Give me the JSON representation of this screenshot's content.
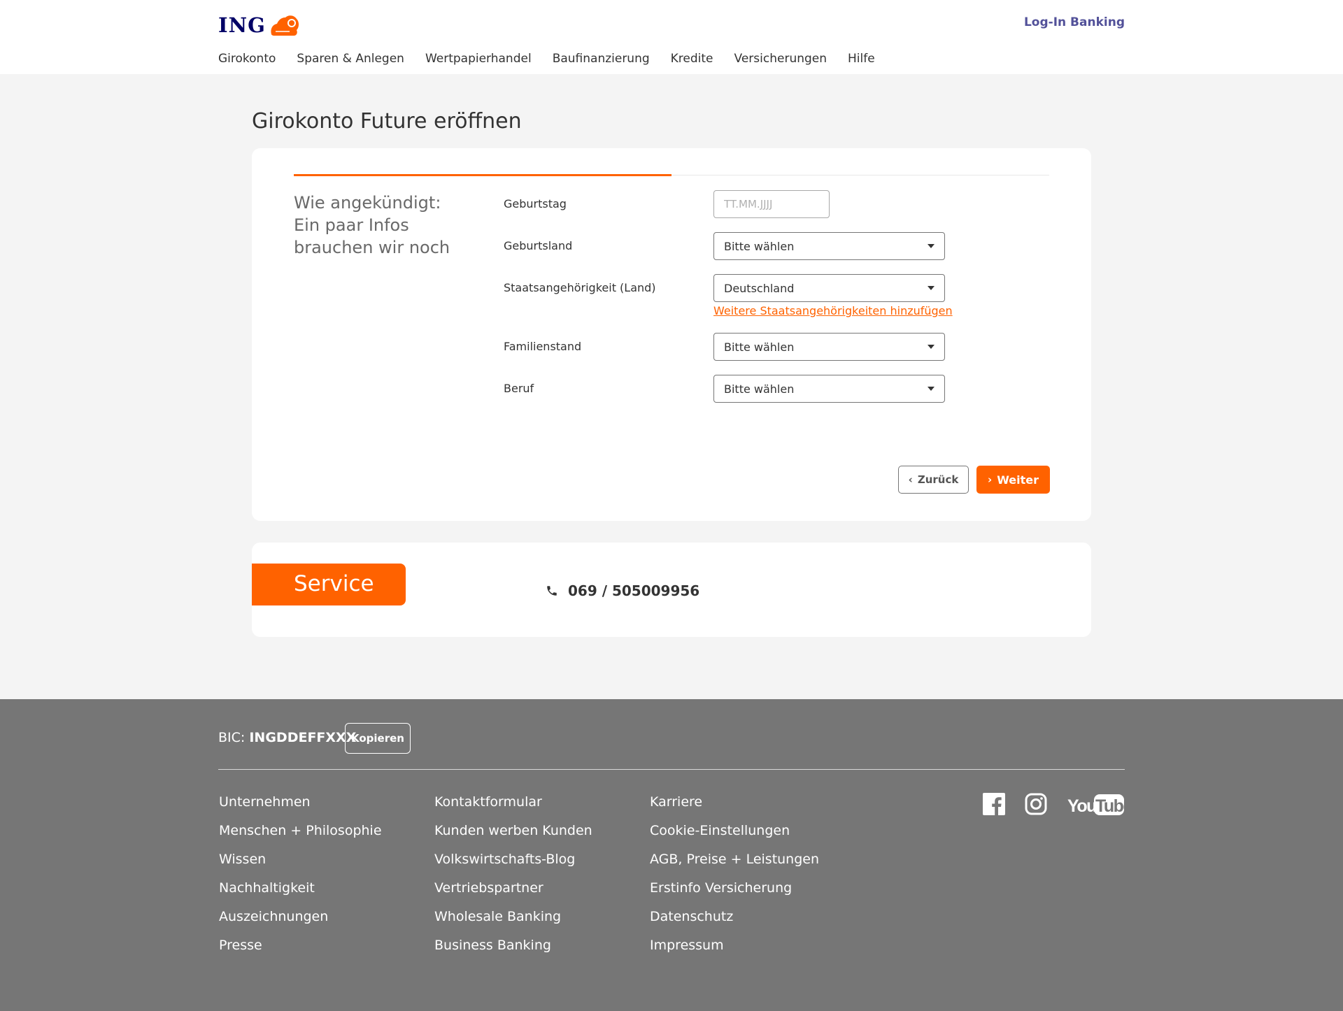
{
  "header": {
    "brand": "ING",
    "login_label": "Log-In Banking",
    "nav": [
      "Girokonto",
      "Sparen & Anlegen",
      "Wertpapierhandel",
      "Baufinanzierung",
      "Kredite",
      "Versicherungen",
      "Hilfe"
    ]
  },
  "page": {
    "title": "Girokonto Future eröffnen"
  },
  "form": {
    "progress": 0.5,
    "intro": "Wie angekündigt: Ein paar Infos brauchen wir noch",
    "birthday": {
      "label": "Geburtstag",
      "placeholder": "TT.MM.JJJJ",
      "value": ""
    },
    "birth_country": {
      "label": "Geburtsland",
      "value": "Bitte wählen"
    },
    "nationality": {
      "label": "Staatsangehörigkeit (Land)",
      "value": "Deutschland"
    },
    "add_nationality_link": "Weitere Staatsangehörigkeiten hinzufügen",
    "marital_status": {
      "label": "Familienstand",
      "value": "Bitte wählen"
    },
    "profession": {
      "label": "Beruf",
      "value": "Bitte wählen"
    },
    "back_label": "Zurück",
    "next_label": "Weiter"
  },
  "service": {
    "title": "Service",
    "phone": "069 / 505009956"
  },
  "footer": {
    "bic_prefix": "BIC:",
    "bic_value": "INGDDEFFXXX",
    "copy_label": "Kopieren",
    "columns": [
      [
        "Unternehmen",
        "Menschen + Philosophie",
        "Wissen",
        "Nachhaltigkeit",
        "Auszeichnungen",
        "Presse"
      ],
      [
        "Kontaktformular",
        "Kunden werben Kunden",
        "Volkswirtschafts-Blog",
        "Vertriebspartner",
        "Wholesale Banking",
        "Business Banking"
      ],
      [
        "Karriere",
        "Cookie-Einstellungen",
        "AGB, Preise + Leistungen",
        "Erstinfo Versicherung",
        "Datenschutz",
        "Impressum"
      ]
    ],
    "social": [
      "facebook-icon",
      "instagram-icon",
      "youtube-icon"
    ]
  },
  "colors": {
    "brand_orange": "#ff6200",
    "brand_navy": "#000066",
    "footer_gray": "#767676"
  }
}
